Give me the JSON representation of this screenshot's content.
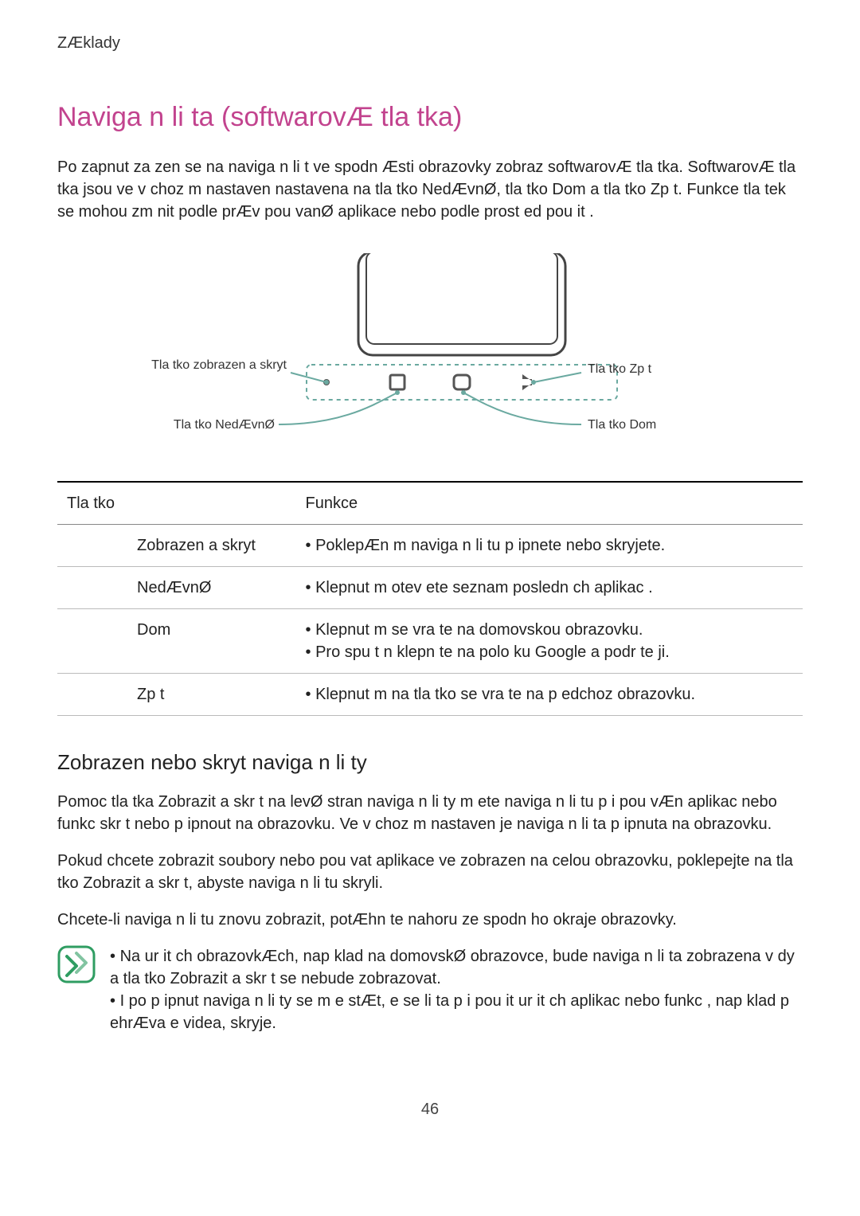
{
  "breadcrumb": "ZÆklady",
  "title": "Naviga n  li ta (softwarovÆ tla tka)",
  "intro": "Po zapnut  za zen  se na naviga n  li t  ve spodn  Æsti obrazovky zobraz  softwarovÆ tla tka. SoftwarovÆ tla tka jsou ve v choz m nastaven  nastavena na tla tko NedÆvnØ, tla tko Dom a tla tko Zp t. Funkce tla tek se mohou zm nit podle prÆv  pou vanØ aplikace nebo podle prost ed  pou it .",
  "diagram": {
    "label_show_hide": "Tla tko zobrazen  a skryt",
    "label_recent": "Tla tko NedÆvnØ",
    "label_back": "Tla tko Zp t",
    "label_home": "Tla tko Dom"
  },
  "table": {
    "head_button": "Tla tko",
    "head_function": "Funkce",
    "rows": [
      {
        "btn": "Zobrazen  a skryt",
        "fn": "PoklepÆn m naviga n  li tu p ipnete nebo skryjete."
      },
      {
        "btn": "NedÆvnØ",
        "fn": "Klepnut m otev ete seznam posledn ch aplikac ."
      },
      {
        "btn": "Dom",
        "fn": "Klepnut m se vra te na domovskou obrazovku.\nPro spu t n  klepn te na polo ku Google a podr te ji."
      },
      {
        "btn": "Zp t",
        "fn": "Klepnut m na tla tko se vra te na p edchoz  obrazovku."
      }
    ]
  },
  "sub_heading": "Zobrazen  nebo skryt  naviga n  li ty",
  "para1": "Pomoc  tla tka Zobrazit a skr t na levØ stran  naviga n  li ty m ete naviga n  li tu p i pou vÆn aplikac  nebo funkc  skr t nebo p ipnout na obrazovku. Ve v choz m nastaven  je naviga n  li ta p ipnuta na obrazovku.",
  "para2": "Pokud chcete zobrazit soubory nebo pou vat aplikace ve zobrazen  na celou obrazovku, poklepejte na tla tko Zobrazit a skr t, abyste naviga n  li tu skryli.",
  "para3": "Chcete-li naviga n  li tu znovu zobrazit, potÆhn te nahoru ze spodn ho okraje obrazovky.",
  "notes": [
    "Na ur it ch obrazovkÆch, nap klad na domovskØ obrazovce, bude naviga n  li ta zobrazena v dy a tla tko Zobrazit a skr t se nebude zobrazovat.",
    "I po p ipnut  naviga n  li ty se m e stÆt, e se li ta p i pou it  ur it ch aplikac  nebo funkc , nap klad p ehrÆva e videa, skryje."
  ],
  "page_number": "46"
}
